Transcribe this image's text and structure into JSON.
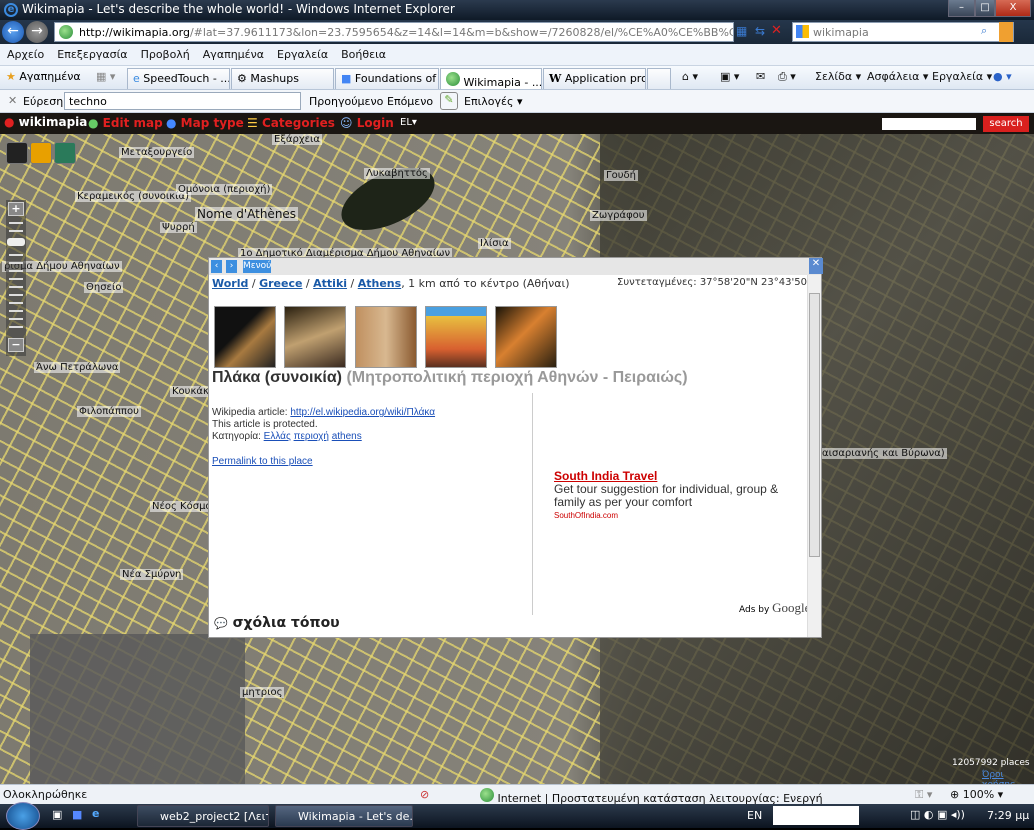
{
  "window": {
    "title": "Wikimapia - Let's describe the whole world! - Windows Internet Explorer",
    "minimize": "–",
    "maximize": "□",
    "close": "X"
  },
  "address": {
    "url_host": "http://wikimapia.org",
    "url_rest": "/#lat=37.9611173&lon=23.7595654&z=14&l=14&m=b&show=/7260828/el/%CE%A0%CE%BB%CE%AC%CE%BA%CE%B1%"
  },
  "search_box": {
    "value": "wikimapia"
  },
  "menu": [
    "Αρχείο",
    "Επεξεργασία",
    "Προβολή",
    "Αγαπημένα",
    "Εργαλεία",
    "Βοήθεια"
  ],
  "favorites_label": "Αγαπημένα",
  "tabs": [
    {
      "label": "SpeedTouch - ..."
    },
    {
      "label": "Mashups"
    },
    {
      "label": "Foundations of ..."
    },
    {
      "label": "Wikimapia - ..."
    },
    {
      "label": "Application pro..."
    }
  ],
  "commands": {
    "page": "Σελίδα ▾",
    "safety": "Ασφάλεια ▾",
    "tools": "Εργαλεία ▾"
  },
  "find": {
    "label": "Εύρεση:",
    "value": "techno",
    "prev": "Προηγούμενο",
    "next": "Επόμενο",
    "options": "Επιλογές"
  },
  "wikimapia": {
    "logo": "wikimapia",
    "edit_map": "Edit map",
    "map_type": "Map type",
    "categories": "Categories",
    "login": "Login",
    "lang": "EL▾",
    "search_btn": "search"
  },
  "map": {
    "labels": [
      "Εξάρχεια",
      "Μεταξουργείο",
      "Λυκαβηττός",
      "Γουδή",
      "Κεραμεικός (συνοικία)",
      "Ομόνοια (περιοχή)",
      "Nome d'Athènes",
      "Ψυρρή",
      "Ζωγράφου",
      "Ιλίσια",
      "1ο Δημοτικό Διαμέρισμα Δήμου Αθηναίων",
      "ρισμα Δήμου Αθηναίων",
      "Θησείο",
      "Άνω Πετράλωνα",
      "Φιλοπάππου",
      "Κουκάκι",
      "Νέος Κόσμος",
      "Νέα Σμύρνη",
      "μητριος",
      "αισαριανής και Βύρωνα)"
    ],
    "places_count": "12057992 places",
    "terms": "Όροι χρήσης"
  },
  "popup": {
    "menu": "Μενού",
    "breadcrumb": [
      "World",
      "Greece",
      "Attiki",
      "Athens"
    ],
    "distance": ", 1 km από το κέντρο (Αθήναι)",
    "coords": "Συντεταγμένες: 37°58'20\"N   23°43'50\"E",
    "title": "Πλάκα (συνοικία)",
    "subtitle": "(Μητροπολιτική περιοχή Αθηνών - Πειραιώς)",
    "wiki_label": "Wikipedia article: ",
    "wiki_link": "http://el.wikipedia.org/wiki/Πλάκα",
    "protected": "This article is protected.",
    "category_label": "Κατηγορία: ",
    "categories": [
      "Ελλάς",
      "περιοχή",
      "athens"
    ],
    "permalink": "Permalink to this place",
    "ad": {
      "title": "South India Travel",
      "text": "Get tour suggestion for individual, group & family as per your comfort",
      "url": "SouthOfIndia.com"
    },
    "ads_by": "Ads by ",
    "ads_brand": "Google",
    "comments": "σχόλια τόπου"
  },
  "status": {
    "text": "Ολοκληρώθηκε",
    "zone": "Internet | Προστατευμένη κατάσταση λειτουργίας: Ενεργή",
    "zoom": "100%"
  },
  "taskbar": {
    "tasks": [
      "web2_project2 [Λειτ...",
      "Wikimapia - Let's de..."
    ],
    "lang": "EN",
    "time": "7:29 μμ"
  }
}
